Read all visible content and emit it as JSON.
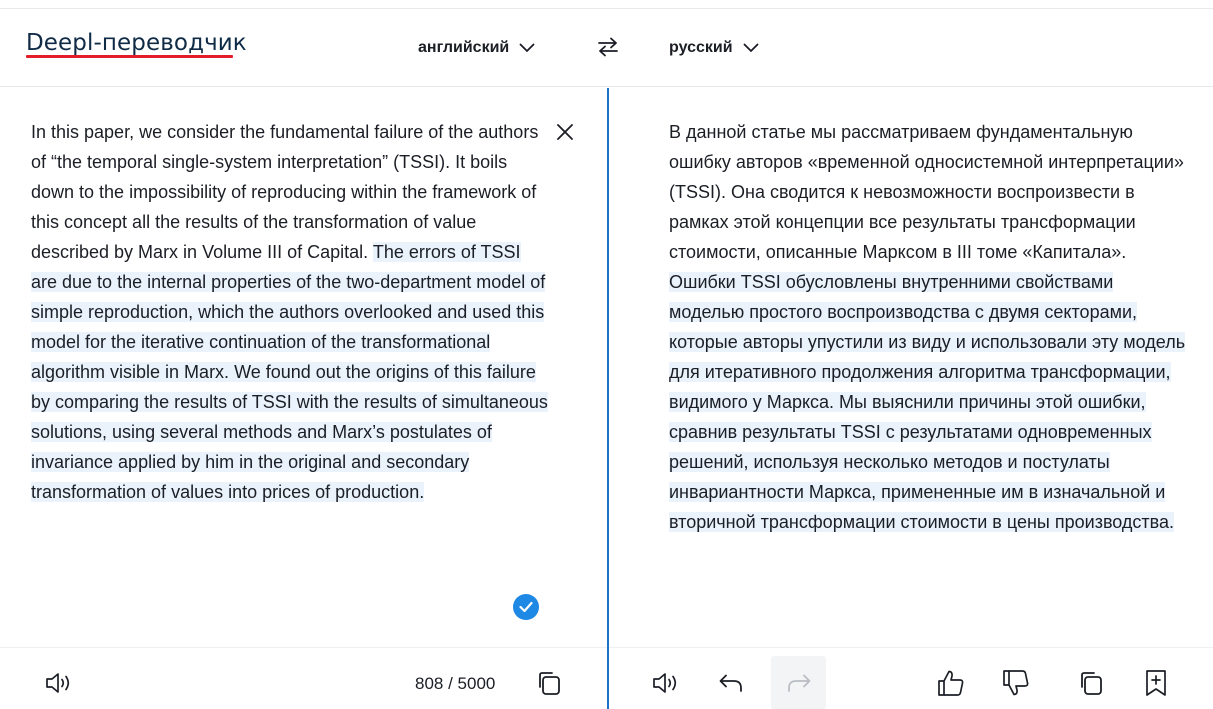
{
  "header": {
    "brand": "Deepl-переводчик",
    "source_language": "английский",
    "target_language": "русский"
  },
  "source": {
    "text_plain": "In this paper, we consider the fundamental failure of the authors of “the temporal single-system interpretation” (TSSI). It boils down to the impossibility of reproducing within the framework of this concept all the results of the transformation of value described by Marx in Volume III of Capital. ",
    "text_highlighted": "The errors of TSSI are due to the internal properties of the two-department model of simple reproduction, which the authors overlooked and used this model for the iterative continuation of the transformational algorithm visible in Marx. We found out the origins of this failure by comparing the results of TSSI with the results of simultaneous solutions, using several methods and Marx’s postulates of invariance applied by him in the original and secondary transformation of values into prices of production.",
    "char_count": "808 / 5000"
  },
  "target": {
    "text_plain": "В данной статье мы рассматриваем фундаментальную ошибку авторов «временной односистемной интерпретации» (TSSI). Она сводится к невозможности воспроизвести в рамках этой концепции все результаты трансформации стоимости, описанные Марксом в III томе «Капитала». ",
    "text_highlighted": "Ошибки TSSI обусловлены внутренними свойствами моделью простого воспроизводства с двумя секторами, которые авторы упустили из виду и использовали эту модель для итеративного продолжения алгоритма трансформации, видимого у Маркса. Мы выяснили причины этой ошибки, сравнив результаты TSSI с результатами одновременных решений, используя несколько методов и постулаты инвариантности Маркса, примененные им в изначальной и вторичной трансформации стоимости в цены производства."
  },
  "colors": {
    "accent": "#1a73c8",
    "brand_underline": "#e41d2a",
    "highlight": "#eaf2fc",
    "check": "#1e88e5"
  },
  "icons": {
    "source_footer": [
      "speaker-icon",
      "copy-icon"
    ],
    "target_footer": [
      "speaker-icon",
      "undo-icon",
      "redo-icon",
      "thumbs-up-icon",
      "thumbs-down-icon",
      "copy-icon",
      "bookmark-add-icon"
    ]
  }
}
